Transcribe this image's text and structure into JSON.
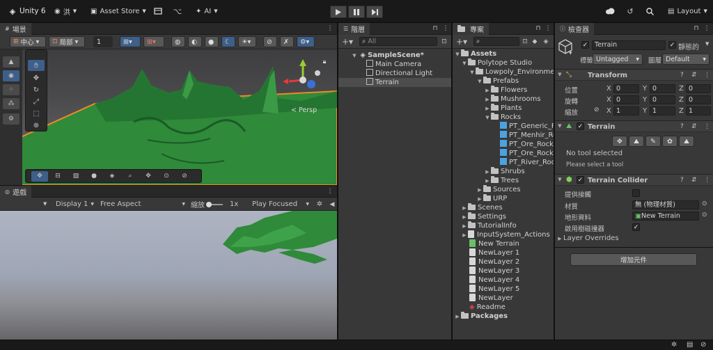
{
  "toolbar": {
    "unity_label": "Unity 6",
    "account_label": "洪",
    "asset_store_label": "Asset Store",
    "ai_label": "AI",
    "layout_label": "Layout"
  },
  "scene": {
    "tab_label": "場景",
    "pivot_label": "中心",
    "space_label": "局部",
    "grid_value": "1",
    "persp_label": "< Persp"
  },
  "game": {
    "tab_label": "遊戲",
    "display_label": "Display 1",
    "aspect_label": "Free Aspect",
    "scale_label": "縮放",
    "scale_value": "1x",
    "play_focus_label": "Play Focused"
  },
  "hierarchy": {
    "tab_label": "階層",
    "search_placeholder": "All",
    "scene_name": "SampleScene*",
    "items": [
      "Main Camera",
      "Directional Light",
      "Terrain"
    ]
  },
  "project": {
    "tab_label": "專案",
    "tree": {
      "assets": "Assets",
      "polytope": "Polytope Studio",
      "lowpoly": "Lowpoly_Environment",
      "prefabs": "Prefabs",
      "flowers": "Flowers",
      "mushrooms": "Mushrooms",
      "plants": "Plants",
      "rocks": "Rocks",
      "rock_items": [
        "PT_Generic_Ro",
        "PT_Menhir_Ro",
        "PT_Ore_Rock_",
        "PT_Ore_Rock_",
        "PT_River_Rock"
      ],
      "shrubs": "Shrubs",
      "trees": "Trees",
      "sources": "Sources",
      "urp": "URP",
      "scenes": "Scenes",
      "settings": "Settings",
      "tutorialinfo": "TutorialInfo",
      "input_actions": "InputSystem_Actions",
      "new_terrain": "New Terrain",
      "layers": [
        "NewLayer 1",
        "NewLayer 2",
        "NewLayer 3",
        "NewLayer 4",
        "NewLayer 5",
        "NewLayer"
      ],
      "readme": "Readme",
      "packages": "Packages"
    }
  },
  "inspector": {
    "tab_label": "檢查器",
    "object_name": "Terrain",
    "static_label": "靜態的",
    "tag_label": "標籤",
    "tag_value": "Untagged",
    "layer_label": "圖層",
    "layer_value": "Default",
    "transform": {
      "title": "Transform",
      "position_label": "位置",
      "rotation_label": "旋轉",
      "scale_label": "縮放",
      "x": "X",
      "y": "Y",
      "z": "Z",
      "position": [
        "0",
        "0",
        "0"
      ],
      "rotation": [
        "0",
        "0",
        "0"
      ],
      "scale": [
        "1",
        "1",
        "1"
      ]
    },
    "terrain": {
      "title": "Terrain",
      "no_tool": "No tool selected",
      "select_tool": "Please select a tool"
    },
    "collider": {
      "title": "Terrain Collider",
      "provides_contacts_label": "提供接觸",
      "material_label": "材質",
      "material_value": "無 (物理材質)",
      "terrain_data_label": "地形資料",
      "terrain_data_value": "New Terrain",
      "enable_tree_label": "啟用樹碰撞器",
      "layer_overrides_label": "Layer Overrides"
    },
    "add_component_label": "增加元件"
  },
  "colors": {
    "terrain_green": "#2f8a3a",
    "selection_orange": "#f08a24",
    "selected_row": "#4d4d4d"
  }
}
